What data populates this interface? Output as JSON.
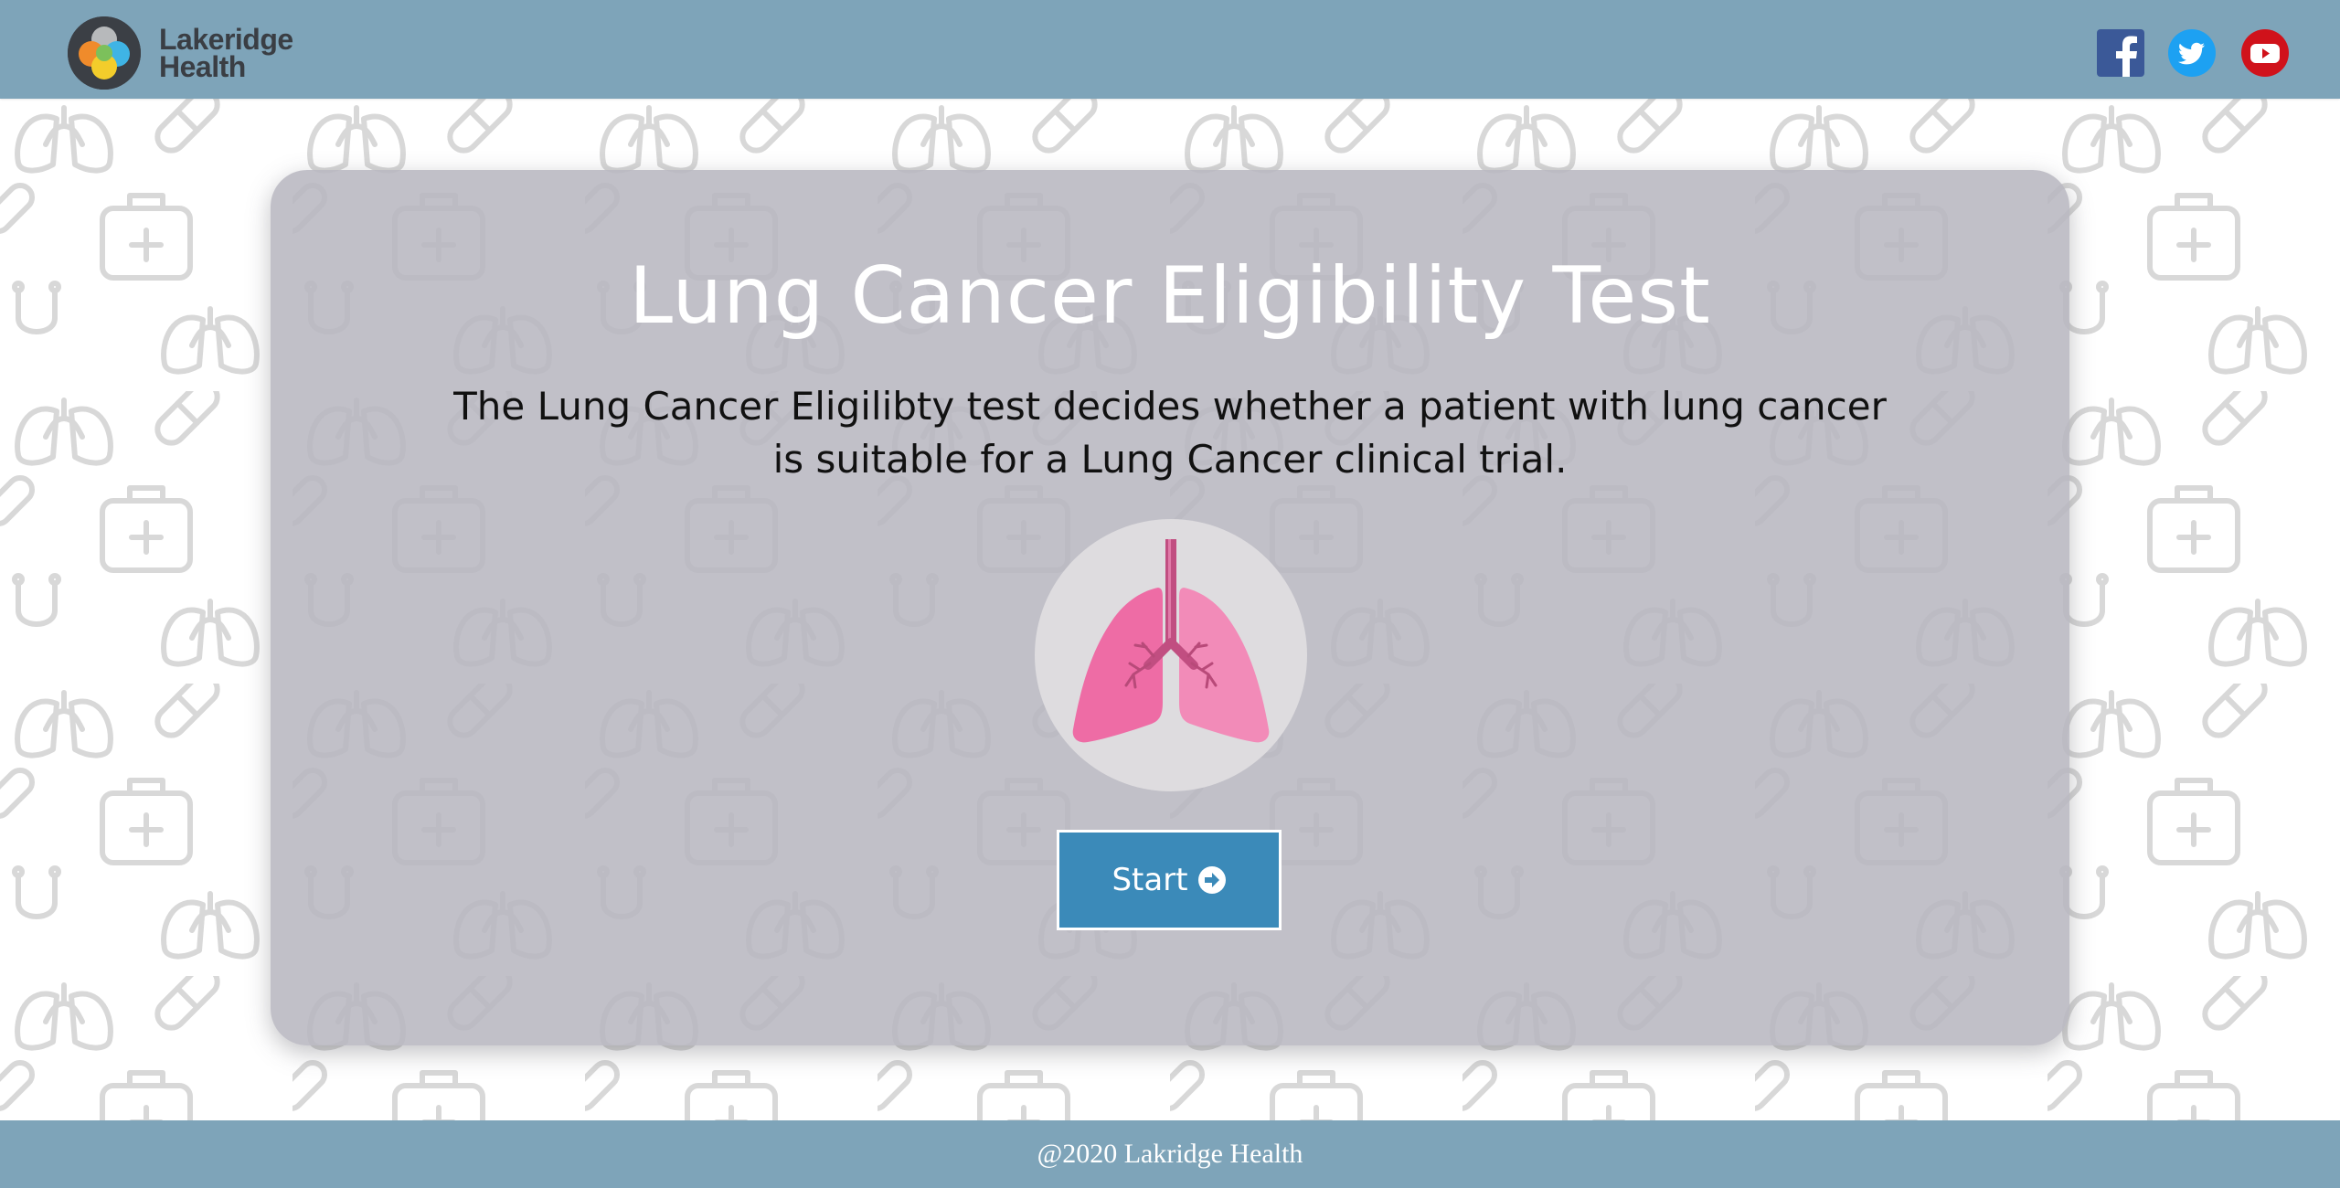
{
  "header": {
    "logo_line1": "Lakeridge",
    "logo_line2": "Health",
    "social": [
      {
        "name": "facebook",
        "icon": "facebook-icon",
        "color": "#3b5998"
      },
      {
        "name": "twitter",
        "icon": "twitter-icon",
        "color": "#1da1f2"
      },
      {
        "name": "youtube",
        "icon": "youtube-icon",
        "color": "#d0121b"
      }
    ]
  },
  "main": {
    "title": "Lung Cancer Eligibility Test",
    "description": "The Lung Cancer Eligilibty test decides whether a patient with lung cancer is suitable for a Lung Cancer clinical trial.",
    "illustration": "lungs-icon",
    "start_label": "Start",
    "start_icon": "arrow-circle-right-icon"
  },
  "footer": {
    "text": "@2020 Lakridge Health"
  },
  "colors": {
    "header_bg": "#7ea4b9",
    "button_bg": "#3b8ab9",
    "card_bg": "#b7b6bf",
    "lung_pink": "#ef6fa4"
  }
}
